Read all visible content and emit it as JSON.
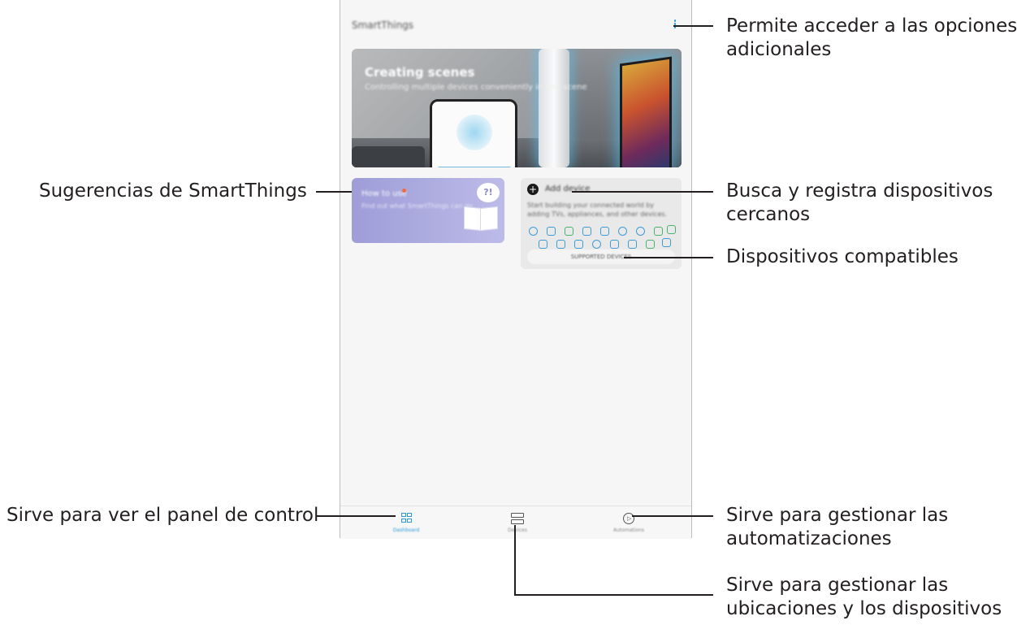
{
  "device": {
    "app_title": "SmartThings",
    "banner": {
      "title": "Creating scenes",
      "subtitle": "Controlling multiple devices conveniently in one scene"
    },
    "tip_card": {
      "title": "How to use",
      "subtitle": "Find out what SmartThings can do",
      "badge": "?!"
    },
    "add_card": {
      "plus": "+",
      "title": "Add device",
      "description": "Start building your connected world by adding TVs, appliances, and other devices.",
      "supported_button": "SUPPORTED DEVICES"
    },
    "nav": {
      "dashboard": "Dashboard",
      "devices": "Devices",
      "automations": "Automations"
    }
  },
  "callouts": {
    "more_options": [
      "Permite acceder a las opciones",
      "adicionales"
    ],
    "suggestions": "Sugerencias de SmartThings",
    "add_device": [
      "Busca y registra dispositivos",
      "cercanos"
    ],
    "supported": "Dispositivos compatibles",
    "dashboard": "Sirve para ver el panel de control",
    "automations": [
      "Sirve para gestionar las",
      "automatizaciones"
    ],
    "devices": [
      "Sirve para gestionar las",
      "ubicaciones y los dispositivos"
    ]
  },
  "colors": {
    "accent": "#2a9bd6",
    "tip_card": "#a9a8dd",
    "text": "#231f20"
  }
}
